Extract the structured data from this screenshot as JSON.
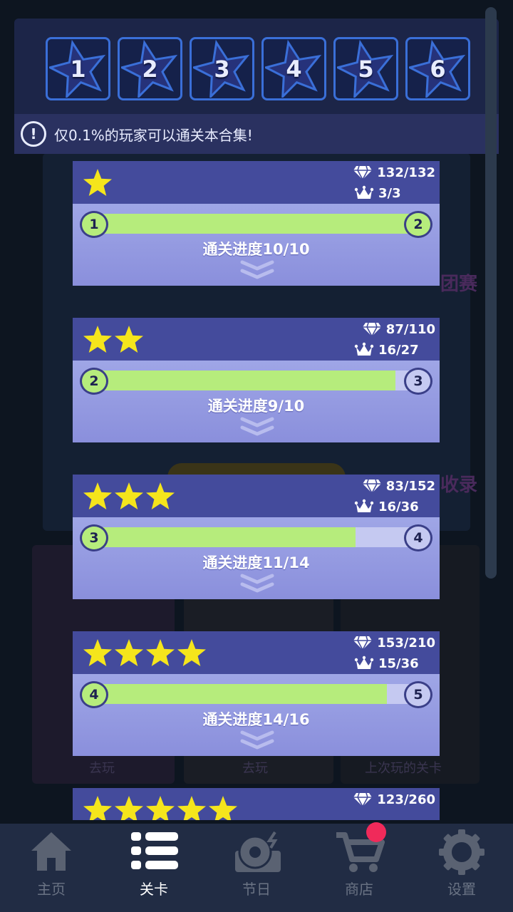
{
  "star_tabs": [
    {
      "label": "1"
    },
    {
      "label": "2"
    },
    {
      "label": "3"
    },
    {
      "label": "4"
    },
    {
      "label": "5"
    },
    {
      "label": "6"
    }
  ],
  "notice": {
    "text": "仅0.1%的玩家可以通关本合集!",
    "icon": "exclamation-icon"
  },
  "background": {
    "word_a": "团赛",
    "word_b": "收录",
    "btn_a": "去玩",
    "btn_b": "去玩",
    "btn_c": "上次玩的关卡"
  },
  "cards": [
    {
      "stars": 1,
      "diamonds": "132/132",
      "crowns": "3/3",
      "from": "1",
      "to": "2",
      "progress_text": "通关进度10/10",
      "progress": 1.0
    },
    {
      "stars": 2,
      "diamonds": "87/110",
      "crowns": "16/27",
      "from": "2",
      "to": "3",
      "progress_text": "通关进度9/10",
      "progress": 0.9
    },
    {
      "stars": 3,
      "diamonds": "83/152",
      "crowns": "16/36",
      "from": "3",
      "to": "4",
      "progress_text": "通关进度11/14",
      "progress": 0.7857
    },
    {
      "stars": 4,
      "diamonds": "153/210",
      "crowns": "15/36",
      "from": "4",
      "to": "5",
      "progress_text": "通关进度14/16",
      "progress": 0.875
    },
    {
      "stars": 5,
      "diamonds": "123/260",
      "crowns": "",
      "from": "",
      "to": "",
      "progress_text": "",
      "progress": 0
    }
  ],
  "nav": [
    {
      "label": "主页",
      "icon": "home-icon",
      "active": false
    },
    {
      "label": "关卡",
      "icon": "list-icon",
      "active": true
    },
    {
      "label": "节日",
      "icon": "record-player-icon",
      "active": false
    },
    {
      "label": "商店",
      "icon": "cart-icon",
      "active": false
    },
    {
      "label": "设置",
      "icon": "gear-icon",
      "active": false
    }
  ],
  "colors": {
    "accent_green": "#b6ec7c",
    "card_header": "#444b9c",
    "star_yellow": "#f5e51c",
    "badge_red": "#f02a5a"
  }
}
